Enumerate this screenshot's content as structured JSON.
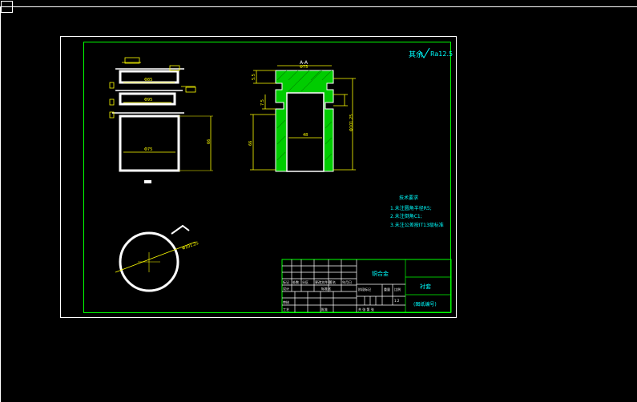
{
  "drawing": {
    "section_label": "A-A",
    "roughness": {
      "prefix": "其余",
      "value": "Ra12.5"
    },
    "tech_requirements": {
      "title": "技术要求",
      "items": [
        "1.未注圆角半径R5;",
        "2.未注倒角C1;",
        "3.未注公差按IT13级标准"
      ]
    },
    "dims": {
      "left_view": [
        "Φ85",
        "Φ95",
        "Φ75",
        "66"
      ],
      "section": [
        "Φ75",
        "48",
        "5.5",
        "7.5",
        "66",
        "Φ101.25"
      ],
      "circle": "Φ101.25"
    },
    "title_block": {
      "material": "铜合金",
      "part_name": "衬套",
      "drawing_no": "(图纸编号)",
      "row_labels": [
        "标记",
        "处数",
        "分区",
        "更改文件号",
        "签名",
        "年月日"
      ],
      "sign_labels": [
        "设计",
        "标准化",
        "审核",
        "工艺",
        "批准"
      ],
      "stage_labels": [
        "阶段标记",
        "重量",
        "比例"
      ],
      "scale": "1:2",
      "sheet": "共 张 第 张"
    }
  },
  "colors": {
    "background": "#000000",
    "frame": "#ffffff",
    "border": "#00ff00",
    "geometry": "#ffffff",
    "dimension": "#ffff00",
    "hatch": "#00cc00",
    "text_cyan": "#00ffff"
  }
}
